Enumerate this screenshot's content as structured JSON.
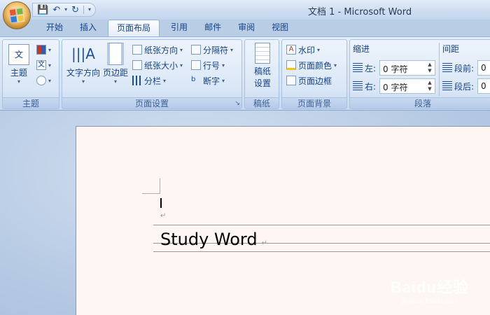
{
  "title_bar": {
    "title": "文档 1 - Microsoft Word"
  },
  "quick_access": {
    "icons": [
      "save-icon",
      "undo-icon",
      "redo-icon",
      "customize-icon"
    ]
  },
  "tabs": [
    {
      "label": "开始"
    },
    {
      "label": "插入"
    },
    {
      "label": "页面布局",
      "active": true
    },
    {
      "label": "引用"
    },
    {
      "label": "邮件"
    },
    {
      "label": "审阅"
    },
    {
      "label": "视图"
    }
  ],
  "ribbon": {
    "theme_group": {
      "label": "主题",
      "themes_button": "主题"
    },
    "page_setup_group": {
      "label": "页面设置",
      "text_direction": "文字方向",
      "margins": "页边距",
      "orientation": "纸张方向",
      "size": "纸张大小",
      "columns": "分栏",
      "breaks": "分隔符",
      "line_numbers": "行号",
      "hyphenation": "断字"
    },
    "manuscript_group": {
      "label": "稿纸",
      "settings_line1": "稿纸",
      "settings_line2": "设置"
    },
    "page_background_group": {
      "label": "页面背景",
      "watermark": "水印",
      "page_color": "页面颜色",
      "page_borders": "页面边框"
    },
    "paragraph_group": {
      "label": "段落",
      "indent_title": "缩进",
      "indent_left_label": "左:",
      "indent_left_value": "0 字符",
      "indent_right_label": "右:",
      "indent_right_value": "0 字符",
      "spacing_title": "间距",
      "spacing_before_label": "段前:",
      "spacing_before_value": "0",
      "spacing_after_label": "段后:",
      "spacing_after_value": "0"
    }
  },
  "document": {
    "text": "Study Word",
    "paragraph_mark": "↵"
  },
  "watermark": {
    "brand": "Baidu经验",
    "url": "jingyan.baidu.com"
  },
  "colors": {
    "ribbon_text": "#15428b",
    "page_background": "#fdf6f3",
    "workspace": "#b7cbe4"
  }
}
